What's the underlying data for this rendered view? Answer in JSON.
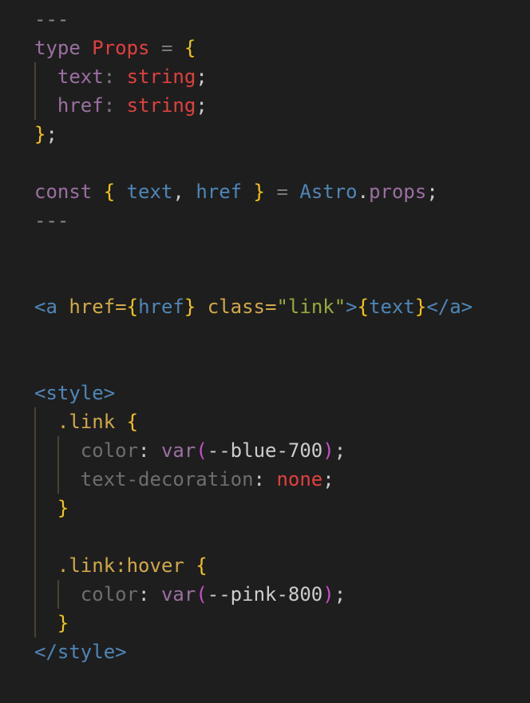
{
  "colors": {
    "background": "#1e1e1e",
    "keyword": "#9b6fa1",
    "type": "#e2403f",
    "brace": "#f5c518",
    "operator": "#7a7a7a",
    "punct": "#cccccc",
    "dim": "#8a8a8a",
    "variable": "#4f86b8",
    "tag": "#4f86b8",
    "attr": "#d2a948",
    "string": "#99a93b",
    "prop": "#6e6e6e",
    "func": "#9b6fa1",
    "paren": "#c84fc8",
    "value": "#e2403f",
    "text": "#cccccc",
    "guide": "#494430"
  },
  "lines": [
    {
      "tokens": [
        {
          "t": "---",
          "c": "dim"
        }
      ]
    },
    {
      "tokens": [
        {
          "t": "type ",
          "c": "keyword"
        },
        {
          "t": "Props",
          "c": "type"
        },
        {
          "t": " = ",
          "c": "operator"
        },
        {
          "t": "{",
          "c": "brace"
        }
      ]
    },
    {
      "tokens": [
        {
          "t": "  text",
          "c": "keyword"
        },
        {
          "t": ": ",
          "c": "operator"
        },
        {
          "t": "string",
          "c": "type"
        },
        {
          "t": ";",
          "c": "punct"
        }
      ]
    },
    {
      "tokens": [
        {
          "t": "  href",
          "c": "keyword"
        },
        {
          "t": ": ",
          "c": "operator"
        },
        {
          "t": "string",
          "c": "type"
        },
        {
          "t": ";",
          "c": "punct"
        }
      ]
    },
    {
      "tokens": [
        {
          "t": "}",
          "c": "brace"
        },
        {
          "t": ";",
          "c": "punct"
        }
      ]
    },
    {
      "tokens": []
    },
    {
      "tokens": [
        {
          "t": "const ",
          "c": "keyword"
        },
        {
          "t": "{ ",
          "c": "brace"
        },
        {
          "t": "text",
          "c": "variable"
        },
        {
          "t": ", ",
          "c": "punct"
        },
        {
          "t": "href",
          "c": "variable"
        },
        {
          "t": " }",
          "c": "brace"
        },
        {
          "t": " = ",
          "c": "operator"
        },
        {
          "t": "Astro",
          "c": "variable"
        },
        {
          "t": ".",
          "c": "punct"
        },
        {
          "t": "props",
          "c": "keyword"
        },
        {
          "t": ";",
          "c": "punct"
        }
      ]
    },
    {
      "tokens": [
        {
          "t": "---",
          "c": "dim"
        }
      ]
    },
    {
      "tokens": []
    },
    {
      "tokens": []
    },
    {
      "tokens": [
        {
          "t": "<a ",
          "c": "tag"
        },
        {
          "t": "href=",
          "c": "attr"
        },
        {
          "t": "{",
          "c": "brace"
        },
        {
          "t": "href",
          "c": "variable"
        },
        {
          "t": "}",
          "c": "brace"
        },
        {
          "t": " class=",
          "c": "attr"
        },
        {
          "t": "\"link\"",
          "c": "string"
        },
        {
          "t": ">",
          "c": "tag"
        },
        {
          "t": "{",
          "c": "brace"
        },
        {
          "t": "text",
          "c": "variable"
        },
        {
          "t": "}",
          "c": "brace"
        },
        {
          "t": "</a>",
          "c": "tag"
        }
      ]
    },
    {
      "tokens": []
    },
    {
      "tokens": []
    },
    {
      "tokens": [
        {
          "t": "<style>",
          "c": "tag"
        }
      ]
    },
    {
      "tokens": [
        {
          "t": "  .link ",
          "c": "attr"
        },
        {
          "t": "{",
          "c": "brace"
        }
      ]
    },
    {
      "tokens": [
        {
          "t": "    color",
          "c": "prop"
        },
        {
          "t": ": ",
          "c": "punct"
        },
        {
          "t": "var",
          "c": "func"
        },
        {
          "t": "(",
          "c": "paren"
        },
        {
          "t": "--blue-700",
          "c": "text"
        },
        {
          "t": ")",
          "c": "paren"
        },
        {
          "t": ";",
          "c": "punct"
        }
      ]
    },
    {
      "tokens": [
        {
          "t": "    text-decoration",
          "c": "prop"
        },
        {
          "t": ": ",
          "c": "punct"
        },
        {
          "t": "none",
          "c": "value"
        },
        {
          "t": ";",
          "c": "punct"
        }
      ]
    },
    {
      "tokens": [
        {
          "t": "  }",
          "c": "brace"
        }
      ]
    },
    {
      "tokens": []
    },
    {
      "tokens": [
        {
          "t": "  .link:hover ",
          "c": "attr"
        },
        {
          "t": "{",
          "c": "brace"
        }
      ]
    },
    {
      "tokens": [
        {
          "t": "    color",
          "c": "prop"
        },
        {
          "t": ": ",
          "c": "punct"
        },
        {
          "t": "var",
          "c": "func"
        },
        {
          "t": "(",
          "c": "paren"
        },
        {
          "t": "--pink-800",
          "c": "text"
        },
        {
          "t": ")",
          "c": "paren"
        },
        {
          "t": ";",
          "c": "punct"
        }
      ]
    },
    {
      "tokens": [
        {
          "t": "  }",
          "c": "brace"
        }
      ]
    },
    {
      "tokens": [
        {
          "t": "</style>",
          "c": "tag"
        }
      ]
    }
  ]
}
